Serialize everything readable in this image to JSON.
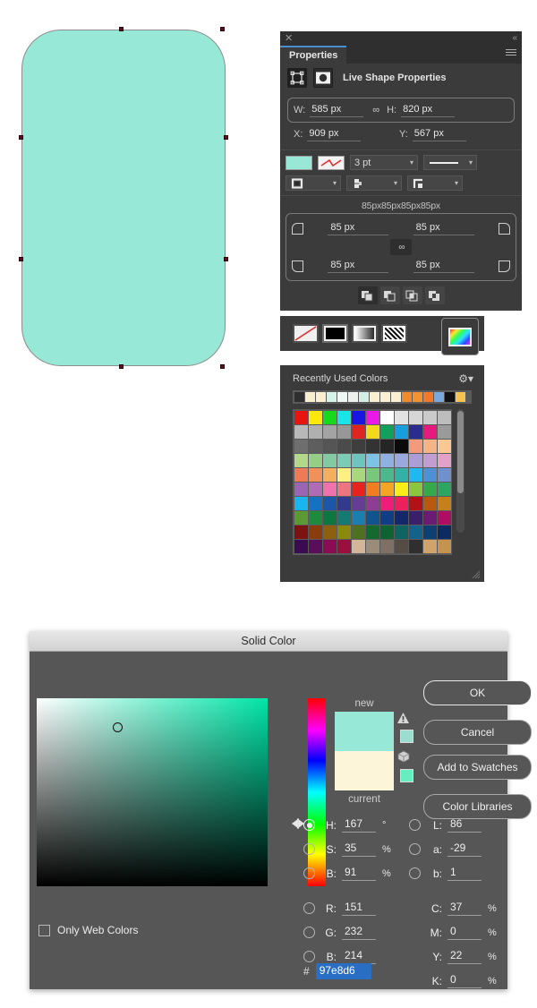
{
  "canvas": {
    "shape_fill": "#97e8d6",
    "shape_stroke": "#8d8d8d",
    "anchor_color": "#5e1020"
  },
  "properties_panel": {
    "close_icon": "✕",
    "collapse_icon": "«",
    "tab_label": "Properties",
    "menu_icon": "hamburger-menu-icon",
    "header_title": "Live Shape Properties",
    "dimensions": {
      "w_label": "W:",
      "w_value": "585 px",
      "link_icon": "∞",
      "h_label": "H:",
      "h_value": "820 px",
      "x_label": "X:",
      "x_value": "909 px",
      "y_label": "Y:",
      "y_value": "567 px"
    },
    "appearance": {
      "fill_color": "#97e8d6",
      "stroke_weight": "3 pt",
      "stroke_style": "solid-line",
      "align_stroke": "align-stroke-icon",
      "cap_style": "cap-style-icon",
      "corner_style": "corner-style-icon"
    },
    "corner_radius": {
      "summary": "85px85px85px85px",
      "top_left": "85 px",
      "top_right": "85 px",
      "bottom_left": "85 px",
      "bottom_right": "85 px",
      "link_icon": "∞"
    },
    "pathfinder": [
      "unite",
      "minus-front",
      "intersect",
      "exclude"
    ]
  },
  "color_mode_bar": {
    "buttons": [
      "none-swatch",
      "solid-black-swatch",
      "gradient-swatch",
      "pattern-swatch"
    ],
    "selected": "color-picker-rainbow"
  },
  "swatches_panel": {
    "title": "Recently Used Colors",
    "gear_icon": "gear-icon",
    "recent": [
      "#2f2f2f",
      "#f7efd0",
      "#faf0cf",
      "#d6f3ea",
      "#eef7f4",
      "#eef1ee",
      "#d3ece4",
      "#fbf0d2",
      "#fbf0d2",
      "#faefcf",
      "#f08a2c",
      "#f3922f",
      "#f2792b",
      "#79a8de",
      "#111111",
      "#f6c352"
    ],
    "grid": [
      "#e8140f",
      "#fbe80d",
      "#17d91c",
      "#19e4e8",
      "#1a15e2",
      "#ea19e5",
      "#ffffff",
      "#e3e3e3",
      "#d6d6d6",
      "#cacaca",
      "#bdbdbd",
      "#b8b8b8",
      "#b0b0b0",
      "#a3a3a3",
      "#979797",
      "#e02420",
      "#f3d91c",
      "#12a15d",
      "#189ede",
      "#2b2d8e",
      "#e6197f",
      "#9a9a9a",
      "#6e6e6e",
      "#5e5e5e",
      "#555555",
      "#4b4b4b",
      "#3e3e3e",
      "#333333",
      "#252525",
      "#0a0a0a",
      "#f49a7c",
      "#f5b388",
      "#f7c894",
      "#b4d889",
      "#95cf86",
      "#83c9a1",
      "#7ccbb5",
      "#6fc4be",
      "#7ec3e6",
      "#8fb0e0",
      "#9aa8dd",
      "#ab9ed6",
      "#c29dd1",
      "#e2a2c8",
      "#ef7a56",
      "#f0915a",
      "#f4ae60",
      "#fbf080",
      "#a9d77d",
      "#77c87a",
      "#4cb98d",
      "#34b1a6",
      "#22b8ef",
      "#4f90d4",
      "#6f8fcd",
      "#9a66b4",
      "#b06bb5",
      "#ef72ad",
      "#ef7481",
      "#e8231e",
      "#f07e20",
      "#f4a523",
      "#f8ed14",
      "#8cc63e",
      "#36a94b",
      "#2da563",
      "#1ab4f0",
      "#1571c2",
      "#1b56a7",
      "#333a8e",
      "#653d95",
      "#8d3d92",
      "#ee1d7a",
      "#ef1f5d",
      "#b31116",
      "#b65a11",
      "#c6801b",
      "#5c9a33",
      "#1d8a3e",
      "#0c7741",
      "#137b74",
      "#1a7fae",
      "#10538f",
      "#103e86",
      "#15276b",
      "#3a1f6b",
      "#6b1b72",
      "#ae0d63",
      "#7c1211",
      "#8a3c0d",
      "#8d6010",
      "#8a8b0d",
      "#4e7021",
      "#146a2e",
      "#0f6333",
      "#0f6461",
      "#13628c",
      "#0d3f73",
      "#0c2b60",
      "#3b0b51",
      "#5a0d58",
      "#8a0d53",
      "#990f3d",
      "#d3b699",
      "#9b8b79",
      "#7e7064",
      "#554c44",
      "#2f2f2f",
      "#d0a36a",
      "#c4934f"
    ]
  },
  "solid_color_dialog": {
    "title": "Solid Color",
    "buttons": {
      "ok": "OK",
      "cancel": "Cancel",
      "add_to_swatches": "Add to Swatches",
      "color_libraries": "Color Libraries"
    },
    "preview": {
      "new_label": "new",
      "current_label": "current",
      "new_color": "#97e8d6",
      "current_color": "#fcf5da",
      "warn_icon": "out-of-gamut-warning-icon",
      "warn_swatch": "#9bddcf",
      "cube_icon": "non-web-safe-icon",
      "cube_swatch": "#66eec0"
    },
    "only_web_colors_label": "Only Web Colors",
    "only_web_colors_checked": false,
    "fields": {
      "H": {
        "label": "H:",
        "value": "167",
        "unit": "°",
        "selected": true
      },
      "S": {
        "label": "S:",
        "value": "35",
        "unit": "%",
        "selected": false
      },
      "Bbright": {
        "label": "B:",
        "value": "91",
        "unit": "%",
        "selected": false
      },
      "R": {
        "label": "R:",
        "value": "151",
        "unit": "",
        "selected": false
      },
      "G": {
        "label": "G:",
        "value": "232",
        "unit": "",
        "selected": false
      },
      "Bblue": {
        "label": "B:",
        "value": "214",
        "unit": "",
        "selected": false
      },
      "L": {
        "label": "L:",
        "value": "86",
        "unit": "",
        "selected": false
      },
      "a": {
        "label": "a:",
        "value": "-29",
        "unit": "",
        "selected": false
      },
      "b": {
        "label": "b:",
        "value": "1",
        "unit": "",
        "selected": false
      },
      "C": {
        "label": "C:",
        "value": "37",
        "unit": "%"
      },
      "M": {
        "label": "M:",
        "value": "0",
        "unit": "%"
      },
      "Y": {
        "label": "Y:",
        "value": "22",
        "unit": "%"
      },
      "K": {
        "label": "K:",
        "value": "0",
        "unit": "%"
      }
    },
    "hex": {
      "prefix": "#",
      "value": "97e8d6"
    }
  }
}
